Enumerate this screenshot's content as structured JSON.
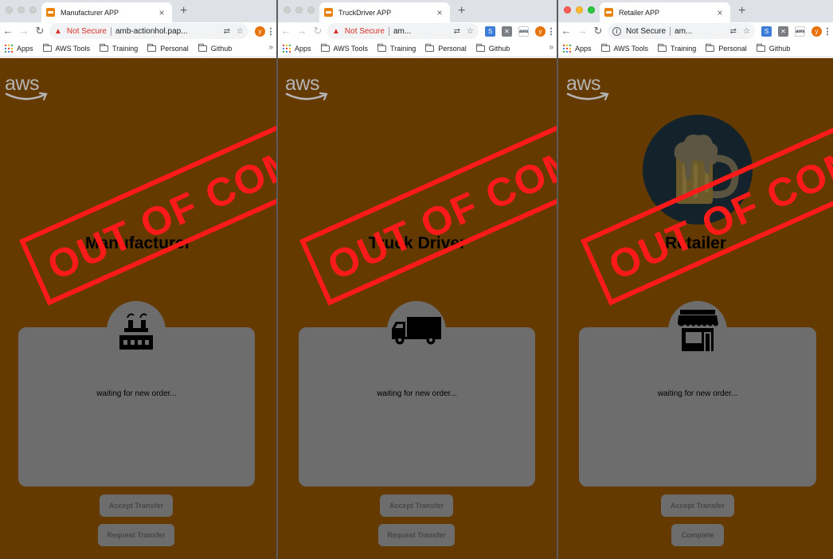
{
  "bookmarks": [
    "Apps",
    "AWS Tools",
    "Training",
    "Personal",
    "Github"
  ],
  "stamp_text": "OUT OF COMPLIANCE",
  "colors": {
    "page_bg": "#653a01",
    "card": "#6d6d6d",
    "stamp": "#ff1a1a",
    "favicon": "#e8820c"
  },
  "windows": [
    {
      "tab_title": "Manufacturer APP",
      "security_label": "Not Secure",
      "url": "amb-actionhol.pap...",
      "role_title": "Manufacturer",
      "role_icon": "factory-icon",
      "status": "waiting for new order...",
      "buttons": [
        "Accept Transfer",
        "Request Transfer"
      ]
    },
    {
      "tab_title": "TruckDriver APP",
      "security_label": "Not Secure",
      "url": "am...",
      "role_title": "Truck Driver",
      "role_icon": "truck-icon",
      "status": "waiting for new order...",
      "buttons": [
        "Accept Transfer",
        "Request Transfer"
      ]
    },
    {
      "tab_title": "Retailer APP",
      "security_label": "Not Secure",
      "url": "am...",
      "role_title": "Retailer",
      "role_icon": "store-icon",
      "status": "waiting for new order...",
      "buttons": [
        "Accept Transfer",
        "Complete"
      ]
    }
  ],
  "profile_initial": "y",
  "logo_text": "aws"
}
